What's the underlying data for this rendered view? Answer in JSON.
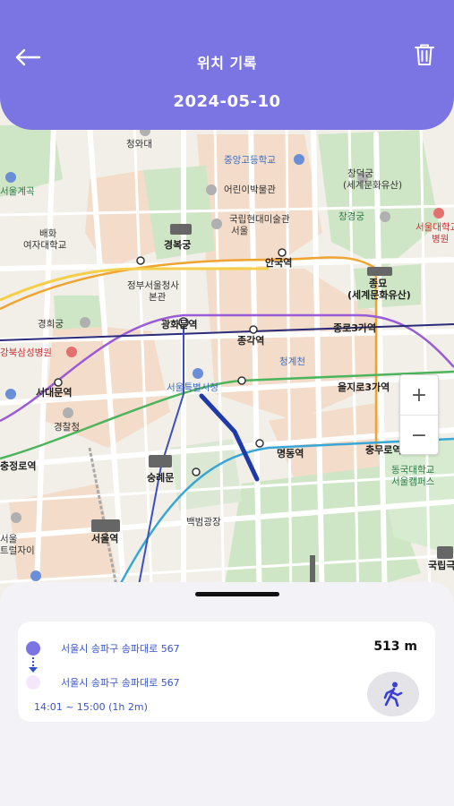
{
  "header": {
    "title": "위치 기록",
    "date": "2024-05-10"
  },
  "map": {
    "labels": {
      "cheongwadae": "청와대",
      "joongang_high": "중앙고등학교",
      "changdeokgung": "창덕궁",
      "changdeokgung_sub": "(세계문화유산)",
      "kids_museum": "어린이박물관",
      "natl_museum": "국립현대미술관",
      "natl_museum_sub": "서울",
      "gyeongbokgung": "경복궁",
      "changgyeonggung": "창경궁",
      "snu_hospital": "서울대학교",
      "snu_hospital_sub": "병원",
      "anguk": "안국역",
      "jongmyo": "종묘",
      "jongmyo_sub": "(세계문화유산)",
      "gov_complex": "정부서울청사",
      "gov_complex_sub": "본관",
      "gyeonghuigung": "경희궁",
      "gwanghwamun": "광화문역",
      "jonggak": "종각역",
      "jongno3": "종로3가역",
      "kangbuk_samsung": "강북삼성병원",
      "cheonggyecheon": "청계천",
      "seodaemun": "서대문역",
      "city_hall": "서울특별시청",
      "euljiro3": "을지로3가역",
      "police": "경찰청",
      "myeongdong": "명동역",
      "chungmuro": "충무로역",
      "chungjeongno": "충정로역",
      "sungnyemun": "숭례문",
      "dongguk": "동국대학교",
      "dongguk_sub": "서울캠퍼스",
      "seoul_station": "서울역",
      "baekbeom": "백범광장",
      "seoul_tower": "서울",
      "tower_sub": "트럴자이",
      "natl_theater": "국립극",
      "ewha": "배화",
      "ewha_sub": "여자대학교",
      "seoul_science": "서울계곡"
    }
  },
  "zoom": {
    "in_label": "+",
    "out_label": "−"
  },
  "record": {
    "start_address": "서울시 송파구 송파대로 567",
    "end_address": "서울시 송파구 송파대로 567",
    "time_range": "14:01 ~ 15:00 (1h 2m)",
    "distance": "513 m"
  },
  "colors": {
    "accent": "#7b75e3",
    "route": "#1f3aa8",
    "start_dot": "#7b75e3",
    "end_dot": "#f4e6fb",
    "link_text": "#3a55c7"
  },
  "icons": {
    "back": "arrow-left-icon",
    "delete": "trash-icon",
    "walk": "walking-person-icon"
  }
}
